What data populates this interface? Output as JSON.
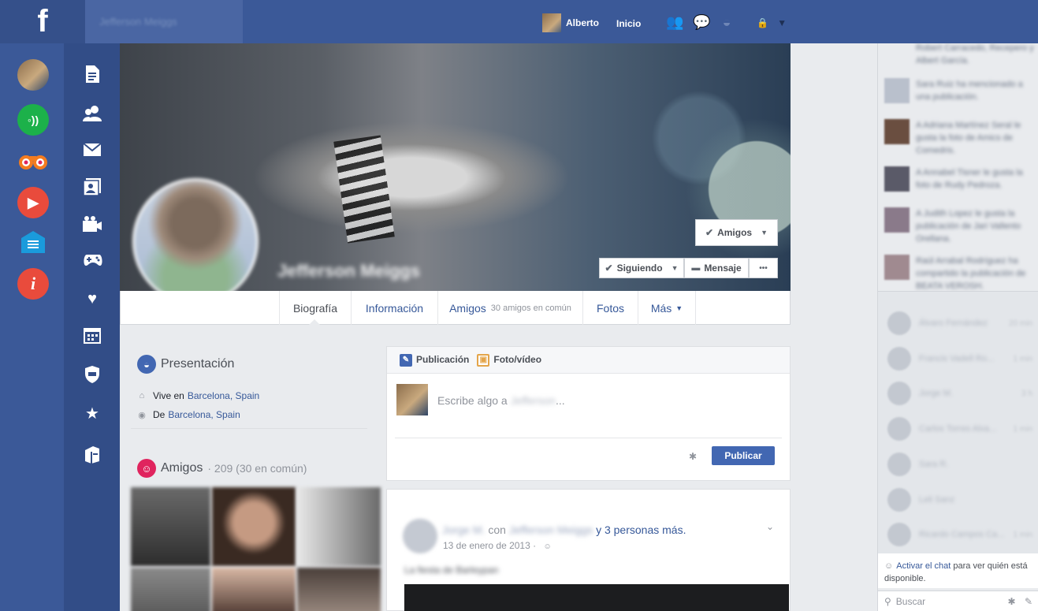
{
  "topbar": {
    "logo": "f",
    "search_placeholder": "Jefferson Meiggs",
    "user_name": "Alberto",
    "home_label": "Inicio",
    "lock_icon": "🔒",
    "chevron": "▼",
    "icons": [
      "friends-icon",
      "messages-icon",
      "notifications-globe-icon",
      "privacy-lock-icon",
      "account-menu-chevron-icon"
    ]
  },
  "left_apps": [
    "avatar",
    "rss-icon",
    "binoculars-icon",
    "play-icon",
    "menu-icon",
    "info-icon"
  ],
  "left_nav": [
    "document-icon",
    "friends-icon",
    "envelope-icon",
    "photos-icon",
    "video-icon",
    "gamepad-icon",
    "heart-icon",
    "calendar-icon",
    "shield-icon",
    "star-icon",
    "archive-icon"
  ],
  "glyphs": {
    "rss": "◦))",
    "play": "▶",
    "menu": "≡",
    "info": "i",
    "document": "📄",
    "friends": "👥",
    "envelope": "✉",
    "photos": "▣",
    "video": "◙",
    "gamepad": "✦",
    "heart": "♥",
    "calendar": "▦",
    "shield": "◈",
    "star": "★",
    "archive": "▤",
    "check": "✔",
    "comment": "💬",
    "dots": "•••",
    "globe": "◒",
    "home": "⌂",
    "pin": "◉",
    "people": "☺",
    "pencil": "✎",
    "picture": "▣",
    "gear": "✱",
    "chev_down": "⌄",
    "search": "⚲",
    "compose": "✎"
  },
  "cover": {
    "profile_name": "Jefferson Meiggs"
  },
  "buttons": {
    "amigos": "Amigos",
    "siguiendo": "Siguiendo",
    "mensaje": "Mensaje",
    "more": "•••"
  },
  "tabs": [
    {
      "label": "Biografía",
      "extra": ""
    },
    {
      "label": "Información",
      "extra": ""
    },
    {
      "label": "Amigos",
      "extra": "30 amigos en común"
    },
    {
      "label": "Fotos",
      "extra": ""
    },
    {
      "label": "Más",
      "extra": "▼"
    }
  ],
  "intro": {
    "title": "Presentación",
    "lives_prefix": "Vive en",
    "lives_place": "Barcelona, Spain",
    "from_prefix": "De",
    "from_place": "Barcelona, Spain"
  },
  "friends": {
    "title": "Amigos",
    "count": "· 209 (30 en común)"
  },
  "composer": {
    "tab_post": "Publicación",
    "tab_photo": "Foto/vídeo",
    "placeholder_prefix": "Escribe algo a",
    "placeholder_name": "Jefferson",
    "placeholder_suffix": "...",
    "publish": "Publicar"
  },
  "post": {
    "author": "Jorge M.",
    "with": "con",
    "tagged": "Jefferson Meiggs",
    "others": "y 3 personas más.",
    "date": "13 de enero de 2013",
    "date_sep": "·",
    "text": "La fiesta de Barleypan"
  },
  "ticker": [
    "Robert Carracedo, Recepero y Albert García.",
    "Sara Ruiz ha mencionado a una publicación.",
    "A Adriana Martínez Seral le gusta la foto de Amics de Comedris.",
    "A Annabel Tisner le gusta la foto de Rudy Pedroza.",
    "A Judith Lopez le gusta la publicación de Jari Vallento Orellana.",
    "Raúl Arrabal Rodríguez ha compartido la publicación de BEATA VEROSH."
  ],
  "chat": {
    "items": [
      {
        "name": "Álvaro Fernández",
        "time": "20 min"
      },
      {
        "name": "Francis Vadell Ro...",
        "time": "1 min"
      },
      {
        "name": "Jorge M.",
        "time": "3 h"
      },
      {
        "name": "Carlos Torres Alva...",
        "time": "1 min"
      },
      {
        "name": "Sara R.",
        "time": ""
      },
      {
        "name": "Leli Sanz",
        "time": ""
      },
      {
        "name": "Ricardo Campos Ca...",
        "time": "1 min"
      }
    ],
    "activate_link": "Activar el chat",
    "activate_rest": "para ver quién está disponible.",
    "search_placeholder": "Buscar"
  }
}
